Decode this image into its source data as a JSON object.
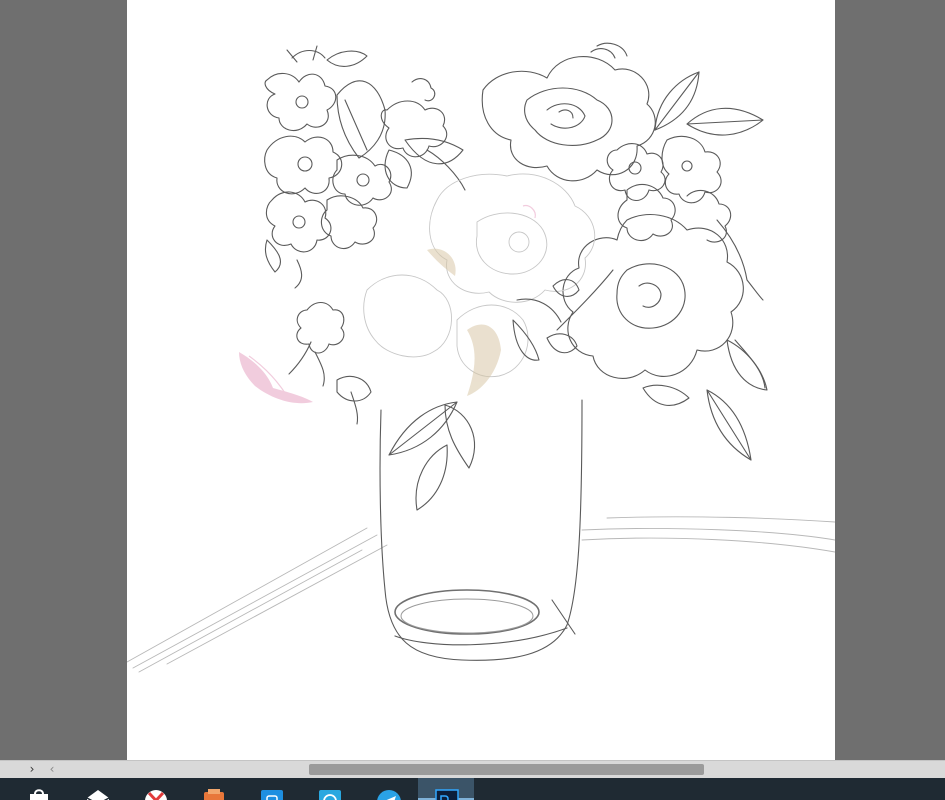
{
  "scrollbar": {
    "panel_toggle_glyph": "›",
    "left_arrow_glyph": "‹"
  },
  "taskbar": {
    "apps": [
      {
        "name": "store",
        "icon": "shopping-bag-icon",
        "color": "#ffffff",
        "active": false
      },
      {
        "name": "mail",
        "icon": "envelope-icon",
        "color": "#ffffff",
        "active": false
      },
      {
        "name": "antivirus",
        "icon": "x-shield-icon",
        "color": "#e23b3b",
        "active": false
      },
      {
        "name": "paint",
        "icon": "palette-icon",
        "color": "#e8773a",
        "active": false
      },
      {
        "name": "photos",
        "icon": "camera-icon",
        "color": "#1e8fe1",
        "active": false
      },
      {
        "name": "messenger",
        "icon": "chat-icon",
        "color": "#2aa8e0",
        "active": false
      },
      {
        "name": "telegram",
        "icon": "paper-plane-icon",
        "color": "#2aa2e6",
        "active": false
      },
      {
        "name": "photoshop",
        "icon": "photoshop-icon",
        "color": "#0c1f3a",
        "active": true
      }
    ]
  },
  "colors": {
    "workspace": "#6f6f6f",
    "canvas": "#ffffff",
    "sketch_line": "#5a5a5a",
    "accent_pink": "#e7a3c2",
    "accent_beige": "#d9c8a8"
  }
}
